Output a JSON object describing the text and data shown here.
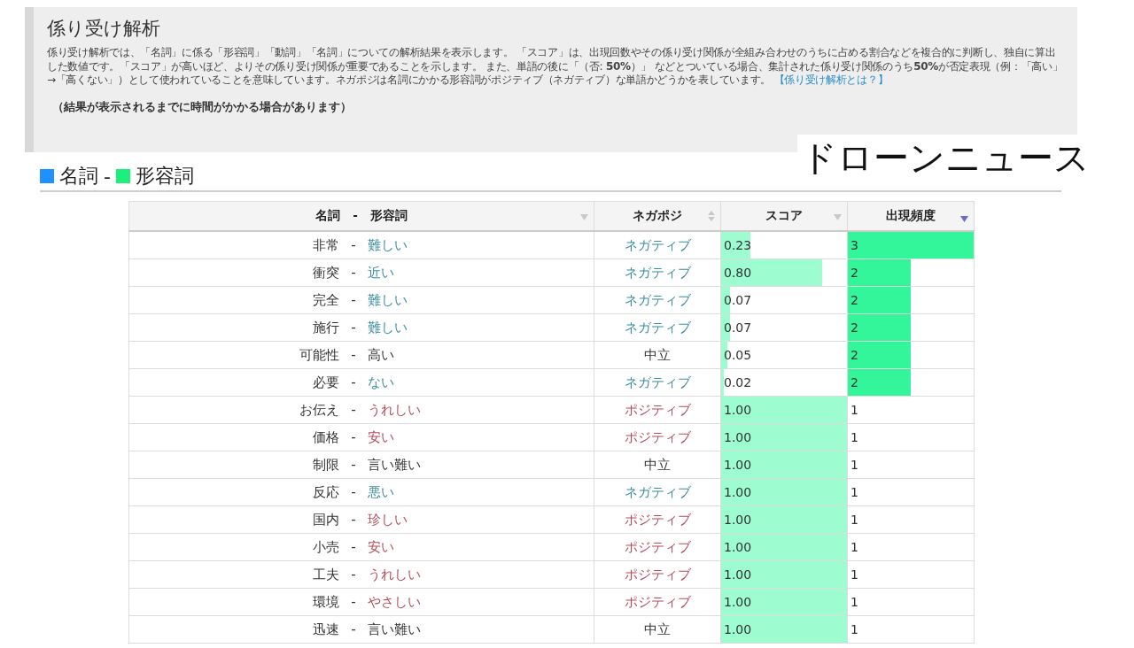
{
  "intro": {
    "title": "係り受け解析",
    "body": "係り受け解析では、「名詞」に係る「形容詞」「動詞」「名詞」についての解析結果を表示します。 「スコア」は、出現回数やその係り受け関係が全組み合わせのうちに占める割合などを複合的に判断し、独自に算出した数値です。「スコア」が高いほど、よりその係り受け関係が重要であることを示します。 また、単語の後に「（否: **50%**）」 などとついている場合、集計された係り受け関係のうち**50%**が否定表現（例：「高い」→「高くない」）として使われていることを意味しています。ネガポジは名詞にかかる形容詞がポジティブ（ネガティブ）な単語かどうかを表しています。",
    "link": "【係り受け解析とは？】",
    "note": "（結果が表示されるまでに時間がかかる場合があります）"
  },
  "overlay_title": "ドローンニュース",
  "section": {
    "separator": "-",
    "legend": [
      {
        "label": "名詞",
        "color": "#1e90ff"
      },
      {
        "label": "形容詞",
        "color": "#1af07a"
      }
    ]
  },
  "table": {
    "columns": [
      {
        "label": "名詞　-　形容詞",
        "kind": "desc",
        "selected": false
      },
      {
        "label": "ネガポジ",
        "kind": "both",
        "selected": false
      },
      {
        "label": "スコア",
        "kind": "desc",
        "selected": false
      },
      {
        "label": "出現頻度",
        "kind": "desc",
        "selected": true
      }
    ],
    "rows": [
      {
        "noun": "非常",
        "sep": "-",
        "adj": "難しい",
        "kind": "negative",
        "negapoji": "ネガティブ",
        "score": {
          "value": "0.23",
          "level": 0.23
        },
        "freq": {
          "value": "3",
          "level": 1
        }
      },
      {
        "noun": "衝突",
        "sep": "-",
        "adj": "近い",
        "kind": "negative",
        "negapoji": "ネガティブ",
        "score": {
          "value": "0.80",
          "level": 0.8
        },
        "freq": {
          "value": "2",
          "level": 0.5
        }
      },
      {
        "noun": "完全",
        "sep": "-",
        "adj": "難しい",
        "kind": "negative",
        "negapoji": "ネガティブ",
        "score": {
          "value": "0.07",
          "level": 0.07
        },
        "freq": {
          "value": "2",
          "level": 0.5
        }
      },
      {
        "noun": "施行",
        "sep": "-",
        "adj": "難しい",
        "kind": "negative",
        "negapoji": "ネガティブ",
        "score": {
          "value": "0.07",
          "level": 0.07
        },
        "freq": {
          "value": "2",
          "level": 0.5
        }
      },
      {
        "noun": "可能性",
        "sep": "-",
        "adj": "高い",
        "kind": "neutral",
        "negapoji": "中立",
        "score": {
          "value": "0.05",
          "level": 0.05
        },
        "freq": {
          "value": "2",
          "level": 0.5
        }
      },
      {
        "noun": "必要",
        "sep": "-",
        "adj": "ない",
        "kind": "negative",
        "negapoji": "ネガティブ",
        "score": {
          "value": "0.02",
          "level": 0.02
        },
        "freq": {
          "value": "2",
          "level": 0.5
        }
      },
      {
        "noun": "お伝え",
        "sep": "-",
        "adj": "うれしい",
        "kind": "positive",
        "negapoji": "ポジティブ",
        "score": {
          "value": "1.00",
          "level": 1
        },
        "freq": {
          "value": "1"
        }
      },
      {
        "noun": "価格",
        "sep": "-",
        "adj": "安い",
        "kind": "positive",
        "negapoji": "ポジティブ",
        "score": {
          "value": "1.00",
          "level": 1
        },
        "freq": {
          "value": "1"
        }
      },
      {
        "noun": "制限",
        "sep": "-",
        "adj": "言い難い",
        "kind": "neutral",
        "negapoji": "中立",
        "score": {
          "value": "1.00",
          "level": 1
        },
        "freq": {
          "value": "1"
        }
      },
      {
        "noun": "反応",
        "sep": "-",
        "adj": "悪い",
        "kind": "negative",
        "negapoji": "ネガティブ",
        "score": {
          "value": "1.00",
          "level": 1
        },
        "freq": {
          "value": "1"
        }
      },
      {
        "noun": "国内",
        "sep": "-",
        "adj": "珍しい",
        "kind": "positive",
        "negapoji": "ポジティブ",
        "score": {
          "value": "1.00",
          "level": 1
        },
        "freq": {
          "value": "1"
        }
      },
      {
        "noun": "小売",
        "sep": "-",
        "adj": "安い",
        "kind": "positive",
        "negapoji": "ポジティブ",
        "score": {
          "value": "1.00",
          "level": 1
        },
        "freq": {
          "value": "1"
        }
      },
      {
        "noun": "工夫",
        "sep": "-",
        "adj": "うれしい",
        "kind": "positive",
        "negapoji": "ポジティブ",
        "score": {
          "value": "1.00",
          "level": 1
        },
        "freq": {
          "value": "1"
        }
      },
      {
        "noun": "環境",
        "sep": "-",
        "adj": "やさしい",
        "kind": "positive",
        "negapoji": "ポジティブ",
        "score": {
          "value": "1.00",
          "level": 1
        },
        "freq": {
          "value": "1"
        }
      },
      {
        "noun": "迅速",
        "sep": "-",
        "adj": "言い難い",
        "kind": "neutral",
        "negapoji": "中立",
        "score": {
          "value": "1.00",
          "level": 1
        },
        "freq": {
          "value": "1"
        }
      }
    ]
  }
}
